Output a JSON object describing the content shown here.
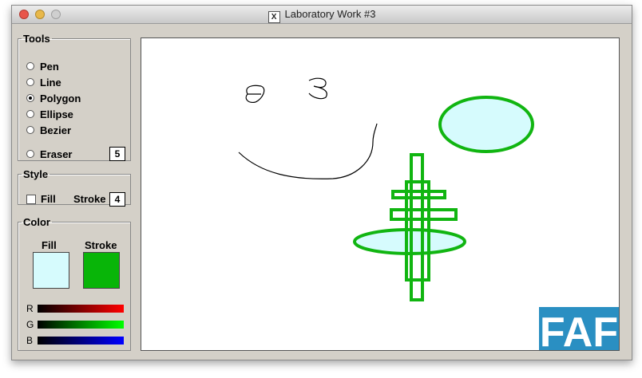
{
  "window": {
    "title": "Laboratory Work #3"
  },
  "tools": {
    "legend": "Tools",
    "items": [
      {
        "label": "Pen",
        "checked": false
      },
      {
        "label": "Line",
        "checked": false
      },
      {
        "label": "Polygon",
        "checked": true
      },
      {
        "label": "Ellipse",
        "checked": false
      },
      {
        "label": "Bezier",
        "checked": false
      },
      {
        "label": "Eraser",
        "checked": false
      }
    ],
    "eraser_size": "5"
  },
  "style": {
    "legend": "Style",
    "fill_label": "Fill",
    "fill_checked": false,
    "stroke_label": "Stroke",
    "stroke_width": "4"
  },
  "color": {
    "legend": "Color",
    "fill_label": "Fill",
    "stroke_label": "Stroke",
    "fill_color": "#d6fbfd",
    "stroke_color": "#08b508",
    "channels": [
      {
        "label": "R",
        "color": "#ff0000"
      },
      {
        "label": "G",
        "color": "#00ff00"
      },
      {
        "label": "B",
        "color": "#0000ff"
      }
    ]
  },
  "canvas": {
    "shape_stroke_color": "#11b511",
    "shape_fill_color": "#d6fbfd",
    "logo_text": "FAF",
    "logo_color": "#2a8fc2"
  }
}
